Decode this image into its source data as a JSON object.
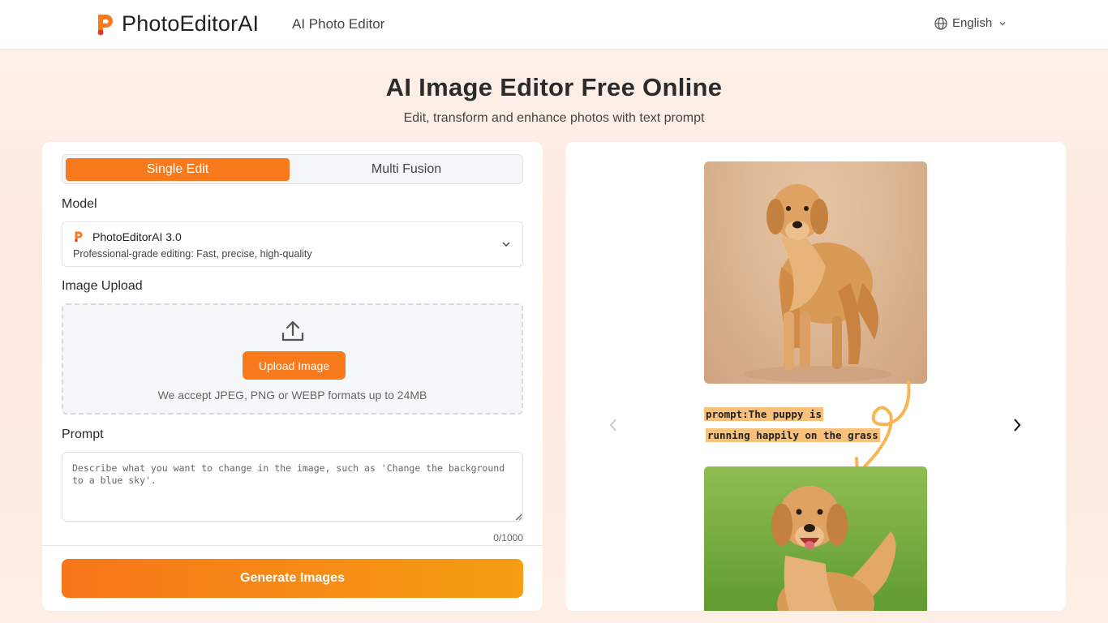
{
  "header": {
    "brand": "PhotoEditorAI",
    "nav_link": "AI Photo Editor",
    "language": "English"
  },
  "hero": {
    "title": "AI Image Editor Free Online",
    "subtitle": "Edit, transform and enhance photos with text prompt"
  },
  "form": {
    "tabs": [
      {
        "label": "Single Edit",
        "active": true
      },
      {
        "label": "Multi Fusion",
        "active": false
      }
    ],
    "model_label": "Model",
    "model": {
      "name": "PhotoEditorAI 3.0",
      "description": "Professional-grade editing: Fast, precise, high-quality"
    },
    "upload_label": "Image Upload",
    "upload_button": "Upload Image",
    "upload_note": "We accept JPEG, PNG or WEBP formats up to 24MB",
    "prompt_label": "Prompt",
    "prompt_placeholder": "Describe what you want to change in the image, such as 'Change the background to a blue sky'.",
    "char_count": "0/1000",
    "generate_button": "Generate Images"
  },
  "preview": {
    "prompt_line1": "prompt:The puppy is",
    "prompt_line2": "running happily on the grass"
  },
  "colors": {
    "accent": "#f97a1c",
    "accent_gradient_end": "#f59e12",
    "highlight": "#f9c07a"
  }
}
